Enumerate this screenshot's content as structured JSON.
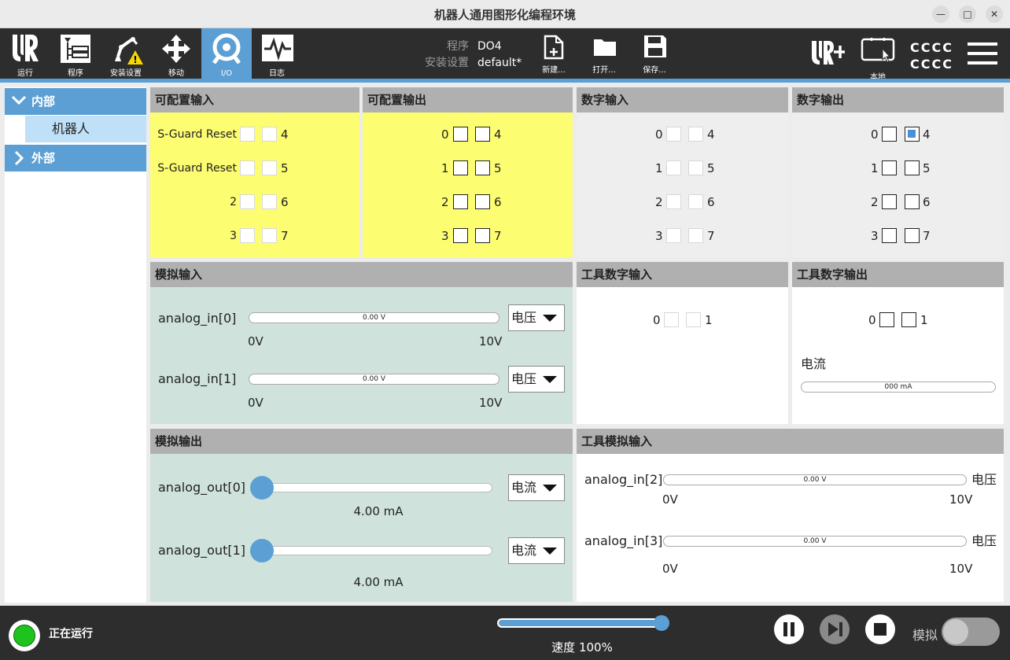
{
  "window": {
    "title": "机器人通用图形化编程环境",
    "minimize": "—",
    "maximize": "□",
    "close": "✕"
  },
  "nav": [
    {
      "label": "运行",
      "icon": "ur-logo-icon"
    },
    {
      "label": "程序",
      "icon": "program-tree-icon"
    },
    {
      "label": "安装设置",
      "icon": "robot-arm-warning-icon"
    },
    {
      "label": "移动",
      "icon": "move-arrows-icon"
    },
    {
      "label": "I/O",
      "icon": "io-icon"
    },
    {
      "label": "日志",
      "icon": "log-chart-icon"
    }
  ],
  "program": {
    "program_label": "程序",
    "program_value": "DO4",
    "install_label": "安装设置",
    "install_value": "default*"
  },
  "file_buttons": [
    {
      "label": "新建...",
      "icon": "new-file-icon"
    },
    {
      "label": "打开...",
      "icon": "open-folder-icon"
    },
    {
      "label": "保存...",
      "icon": "save-disk-icon"
    }
  ],
  "right": {
    "local_label": "本地",
    "cccc_top": "CCCC",
    "cccc_bottom": "CCCC"
  },
  "tree": {
    "internal": "内部",
    "robot": "机器人",
    "external": "外部"
  },
  "config_input": {
    "title": "可配置输入",
    "rows": [
      {
        "label": "S-Guard Reset",
        "right": "4"
      },
      {
        "label": "S-Guard Reset",
        "right": "5"
      },
      {
        "label": "2",
        "right": "6"
      },
      {
        "label": "3",
        "right": "7"
      }
    ]
  },
  "config_output": {
    "title": "可配置输出",
    "rows": [
      {
        "left": "0",
        "right": "4"
      },
      {
        "left": "1",
        "right": "5"
      },
      {
        "left": "2",
        "right": "6"
      },
      {
        "left": "3",
        "right": "7"
      }
    ]
  },
  "digital_input": {
    "title": "数字输入",
    "rows": [
      {
        "left": "0",
        "right": "4"
      },
      {
        "left": "1",
        "right": "5"
      },
      {
        "left": "2",
        "right": "6"
      },
      {
        "left": "3",
        "right": "7"
      }
    ]
  },
  "digital_output": {
    "title": "数字输出",
    "rows": [
      {
        "left": "0",
        "right": "4",
        "right_checked": true
      },
      {
        "left": "1",
        "right": "5"
      },
      {
        "left": "2",
        "right": "6"
      },
      {
        "left": "3",
        "right": "7"
      }
    ]
  },
  "analog_input": {
    "title": "模拟输入",
    "items": [
      {
        "name": "analog_in[0]",
        "value": "0.00 V",
        "min": "0V",
        "max": "10V",
        "mode": "电压"
      },
      {
        "name": "analog_in[1]",
        "value": "0.00 V",
        "min": "0V",
        "max": "10V",
        "mode": "电压"
      }
    ]
  },
  "tool_digital_input": {
    "title": "工具数字输入",
    "left": "0",
    "right": "1"
  },
  "tool_digital_output": {
    "title": "工具数字输出",
    "left": "0",
    "right": "1",
    "current_label": "电流",
    "current_value": "000 mA"
  },
  "analog_output": {
    "title": "模拟输出",
    "items": [
      {
        "name": "analog_out[0]",
        "value": "4.00 mA",
        "mode": "电流",
        "level": 0
      },
      {
        "name": "analog_out[1]",
        "value": "4.00 mA",
        "mode": "电流",
        "level": 0
      }
    ]
  },
  "tool_analog_input": {
    "title": "工具模拟输入",
    "items": [
      {
        "name": "analog_in[2]",
        "value": "0.00 V",
        "min": "0V",
        "max": "10V",
        "mode": "电压"
      },
      {
        "name": "analog_in[3]",
        "value": "0.00 V",
        "min": "0V",
        "max": "10V",
        "mode": "电压"
      }
    ]
  },
  "bottom": {
    "status": "正在运行",
    "speed_label": "速度 100%",
    "speed_level": 1.0,
    "simulate_label": "模拟",
    "simulate_on": false
  },
  "colors": {
    "accent": "#5b9fd4",
    "yellow": "#fdfd71",
    "green_panel": "#cfe3dc",
    "status_green": "#1ec31e",
    "bar": "#2d2d2d"
  }
}
